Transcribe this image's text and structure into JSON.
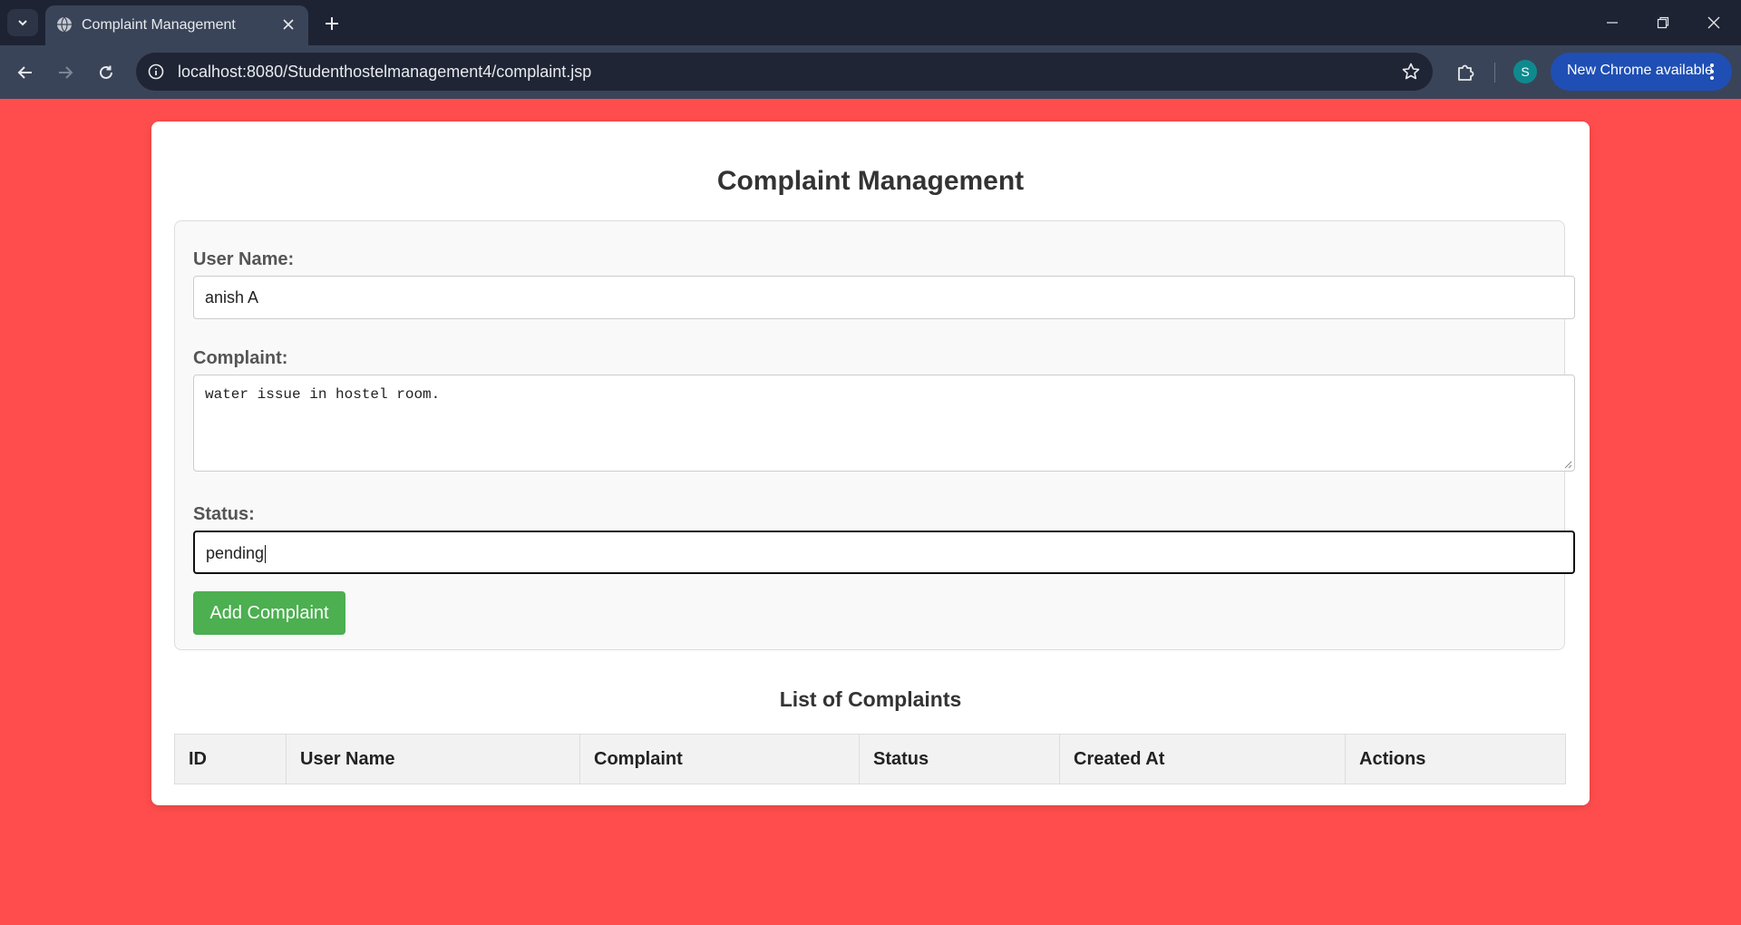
{
  "browser": {
    "tab_title": "Complaint Management",
    "url": "localhost:8080/Studenthostelmanagement4/complaint.jsp",
    "profile_initial": "S",
    "update_label": "New Chrome available"
  },
  "page": {
    "title": "Complaint Management",
    "form": {
      "user_name_label": "User Name:",
      "user_name_value": "anish A",
      "complaint_label": "Complaint:",
      "complaint_value": "water issue in hostel room.",
      "status_label": "Status:",
      "status_value": "pending",
      "submit_label": "Add Complaint"
    },
    "list_title": "List of Complaints",
    "table": {
      "columns": [
        "ID",
        "User Name",
        "Complaint",
        "Status",
        "Created At",
        "Actions"
      ],
      "rows": []
    }
  },
  "colors": {
    "page_background": "#ff4d4d",
    "button_green": "#4caf50",
    "chrome_dark": "#1d2333",
    "update_blue": "#1f4fb4"
  }
}
